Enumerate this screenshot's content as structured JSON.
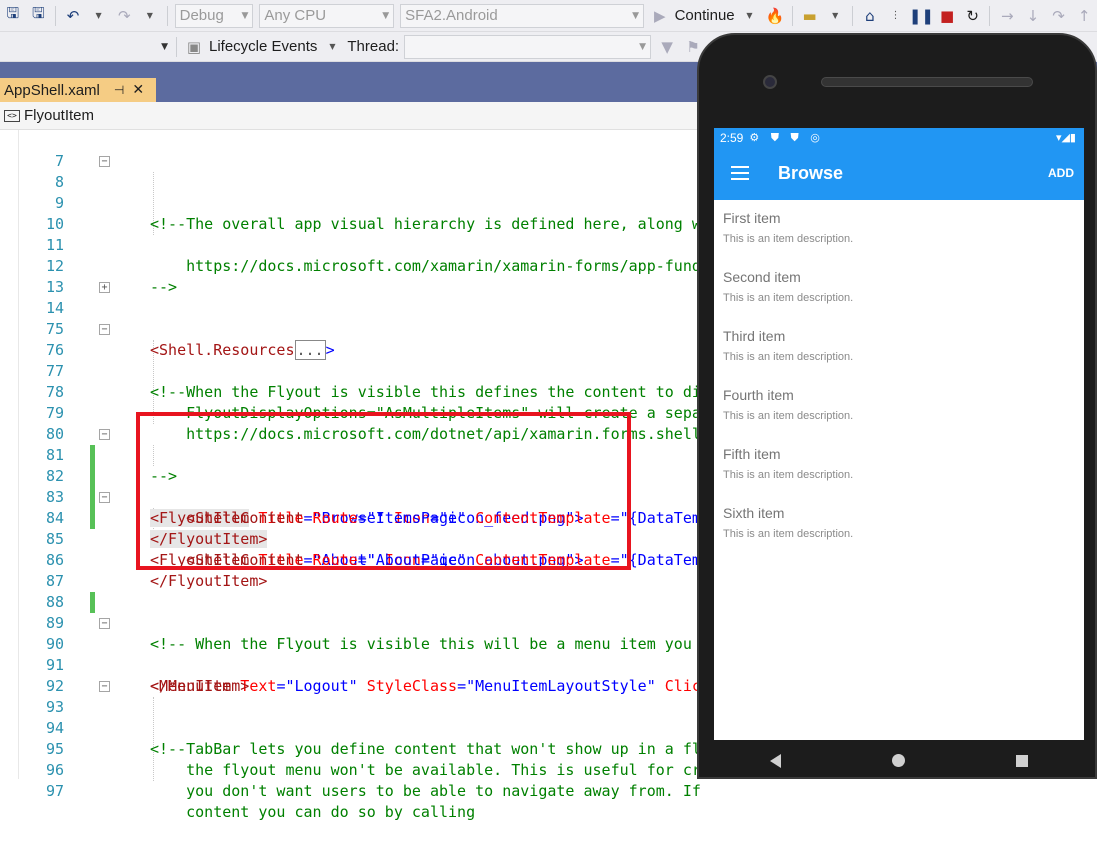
{
  "toolbar": {
    "configuration": "Debug",
    "platform": "Any CPU",
    "startup_project": "SFA2.Android",
    "continue_label": "Continue",
    "lifecycle_events": "Lifecycle Events",
    "thread_label": "Thread:"
  },
  "tab": {
    "title": "AppShell.xaml",
    "pin": "⊣",
    "close": "✕"
  },
  "navbar": {
    "label": "FlyoutItem"
  },
  "code": {
    "lines": [
      {
        "n": "7"
      },
      {
        "n": "8"
      },
      {
        "n": "9"
      },
      {
        "n": "10"
      },
      {
        "n": "11"
      },
      {
        "n": "12"
      },
      {
        "n": "13"
      },
      {
        "n": "14"
      },
      {
        "n": "75"
      },
      {
        "n": "76"
      },
      {
        "n": "77"
      },
      {
        "n": "78"
      },
      {
        "n": "79"
      },
      {
        "n": "80"
      },
      {
        "n": "81"
      },
      {
        "n": "82"
      },
      {
        "n": "83"
      },
      {
        "n": "84"
      },
      {
        "n": "85"
      },
      {
        "n": "86"
      },
      {
        "n": "87"
      },
      {
        "n": "88"
      },
      {
        "n": "89"
      },
      {
        "n": "90"
      },
      {
        "n": "91"
      },
      {
        "n": "92"
      },
      {
        "n": "93"
      },
      {
        "n": "94"
      },
      {
        "n": "95"
      },
      {
        "n": "96"
      },
      {
        "n": "97"
      }
    ],
    "l8": "<!--",
    "l9": "    The overall app visual hierarchy is defined here, along w",
    "l11": "    https://docs.microsoft.com/xamarin/xamarin-forms/app-fund",
    "l12": "-->",
    "l14_tag": "<Shell.Resources",
    "l14_collapsed": "...",
    "l14_end": ">",
    "l76": "<!--",
    "l77": "    When the Flyout is visible this defines the content to di",
    "l78": "    FlyoutDisplayOptions=\"AsMultipleItems\" will create a sepa",
    "l79": "    https://docs.microsoft.com/dotnet/api/xamarin.forms.shell",
    "l80": "-->",
    "l81_tag": "<FlyoutItem",
    "l81_a1": " Title",
    "l81_v1": "=\"Browse\"",
    "l81_a2": " Icon",
    "l81_v2": "=\"icon_feed.png\"",
    "l81_end": ">",
    "l82_tag": "    <ShellContent",
    "l82_a1": " Route",
    "l82_v1": "=\"ItemsPage\"",
    "l82_a2": " ContentTemplate",
    "l82_v2": "=\"{DataTem",
    "l83_tag": "</FlyoutItem>",
    "l84_tag": "<FlyoutItem",
    "l84_a1": " Title",
    "l84_v1": "=\"About\"",
    "l84_a2": " Icon",
    "l84_v2": "=\"icon_about.png\"",
    "l84_end": ">",
    "l85_tag": "    <ShellContent",
    "l85_a1": " Route",
    "l85_v1": "=\"AboutPage\"",
    "l85_a2": " ContentTemplate",
    "l85_v2": "=\"{DataTem",
    "l86_tag": "</FlyoutItem>",
    "l89": "<!-- When the Flyout is visible this will be a menu item you",
    "l90_tag": "<MenuItem",
    "l90_a1": " Text",
    "l90_v1": "=\"Logout\"",
    "l90_a2": " StyleClass",
    "l90_v2": "=\"MenuItemLayoutStyle\"",
    "l90_a3": " Clic",
    "l91_tag": "</MenuItem>",
    "l93": "<!--",
    "l94": "    TabBar lets you define content that won't show up in a fl",
    "l95": "    the flyout menu won't be available. This is useful for cr",
    "l96": "    you don't want users to be able to navigate away from. If",
    "l97": "    content you can do so by calling"
  },
  "phone": {
    "time": "2:59",
    "status_icons": "⚙ ⛊ ⛊ ◎",
    "status_right": "▾◢▮",
    "title": "Browse",
    "add": "ADD",
    "items": [
      {
        "name": "First item",
        "desc": "This is an item description."
      },
      {
        "name": "Second item",
        "desc": "This is an item description."
      },
      {
        "name": "Third item",
        "desc": "This is an item description."
      },
      {
        "name": "Fourth item",
        "desc": "This is an item description."
      },
      {
        "name": "Fifth item",
        "desc": "This is an item description."
      },
      {
        "name": "Sixth item",
        "desc": "This is an item description."
      }
    ]
  }
}
